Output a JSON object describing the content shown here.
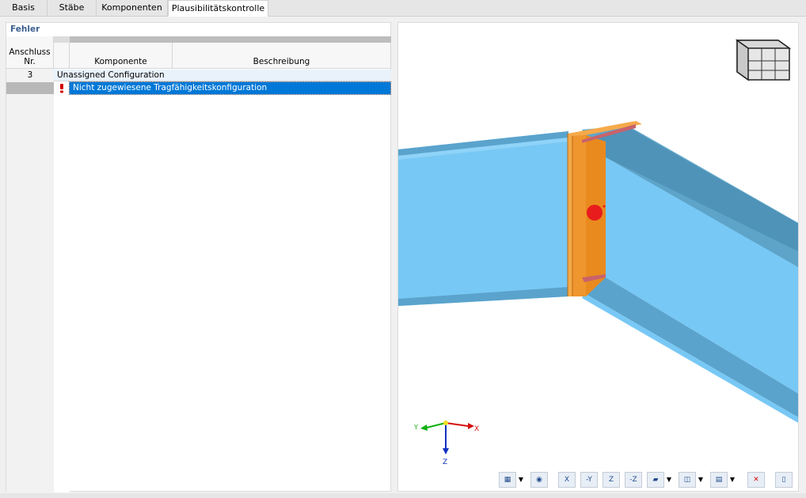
{
  "tabs": [
    {
      "label": "Basis"
    },
    {
      "label": "Stäbe"
    },
    {
      "label": "Komponenten"
    },
    {
      "label": "Plausibilitätskontrolle"
    }
  ],
  "errors_panel": {
    "title": "Fehler",
    "columns": {
      "connection_line1": "Anschluss",
      "connection_line2": "Nr.",
      "component": "Komponente",
      "description": "Beschreibung"
    },
    "group": {
      "number": "3",
      "label": "Unassigned Configuration"
    },
    "rows": [
      {
        "icon": "error-exclamation-icon",
        "description": "Nicht zugewiesene Tragfähigkeitskonfiguration"
      }
    ]
  },
  "viewport": {
    "axes": {
      "x": "X",
      "y": "Y",
      "z": "Z"
    },
    "colors": {
      "beam": "#78c8f5",
      "beam_dark": "#5aa3cc",
      "plate": "#f0962e",
      "marker": "#e81c1c",
      "accent": "#0078d7"
    },
    "toolbar": [
      {
        "icon": "display-settings-icon",
        "label": ""
      },
      {
        "icon": "view-visibility-icon",
        "label": ""
      },
      {
        "icon": "view-x-icon",
        "label": "X"
      },
      {
        "icon": "view-minus-y-icon",
        "label": "-Y"
      },
      {
        "icon": "view-z-icon",
        "label": "Z"
      },
      {
        "icon": "view-minus-z-icon",
        "label": "-Z"
      },
      {
        "icon": "render-mode-icon",
        "label": ""
      },
      {
        "icon": "wireframe-box-icon",
        "label": ""
      },
      {
        "icon": "print-icon",
        "label": ""
      },
      {
        "icon": "reset-zoom-icon",
        "label": ""
      },
      {
        "icon": "panel-toggle-icon",
        "label": ""
      }
    ]
  }
}
